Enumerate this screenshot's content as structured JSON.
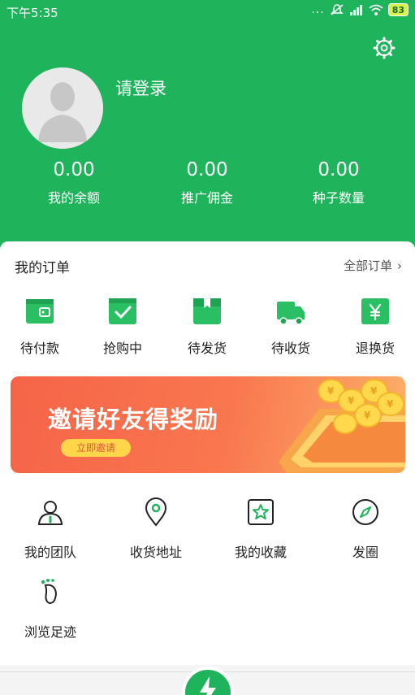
{
  "status_bar": {
    "time": "下午5:35",
    "dots": "...",
    "battery": "83",
    "icons": [
      "silent-icon",
      "signal-icon",
      "wifi-icon",
      "battery-icon"
    ]
  },
  "header": {
    "login_text": "请登录",
    "settings_icon": "gear-icon",
    "stats": [
      {
        "value": "0.00",
        "label": "我的余额"
      },
      {
        "value": "0.00",
        "label": "推广佣金"
      },
      {
        "value": "0.00",
        "label": "种子数量"
      }
    ]
  },
  "orders": {
    "title": "我的订单",
    "all_label": "全部订单",
    "all_chevron": "›",
    "items": [
      {
        "label": "待付款",
        "icon": "wallet-icon"
      },
      {
        "label": "抢购中",
        "icon": "checkbox-icon"
      },
      {
        "label": "待发货",
        "icon": "package-icon"
      },
      {
        "label": "待收货",
        "icon": "truck-icon"
      },
      {
        "label": "退换货",
        "icon": "yen-icon"
      }
    ]
  },
  "banner": {
    "title": "邀请好友得奖励",
    "button": "立即邀请"
  },
  "tools": [
    {
      "label": "我的团队",
      "icon": "team-icon"
    },
    {
      "label": "收货地址",
      "icon": "location-icon"
    },
    {
      "label": "我的收藏",
      "icon": "star-icon"
    },
    {
      "label": "发圈",
      "icon": "compass-icon"
    },
    {
      "label": "浏览足迹",
      "icon": "footprint-icon"
    }
  ],
  "colors": {
    "primary": "#1fb35b",
    "banner": "#f56448",
    "banner_button": "#ffd64a"
  }
}
